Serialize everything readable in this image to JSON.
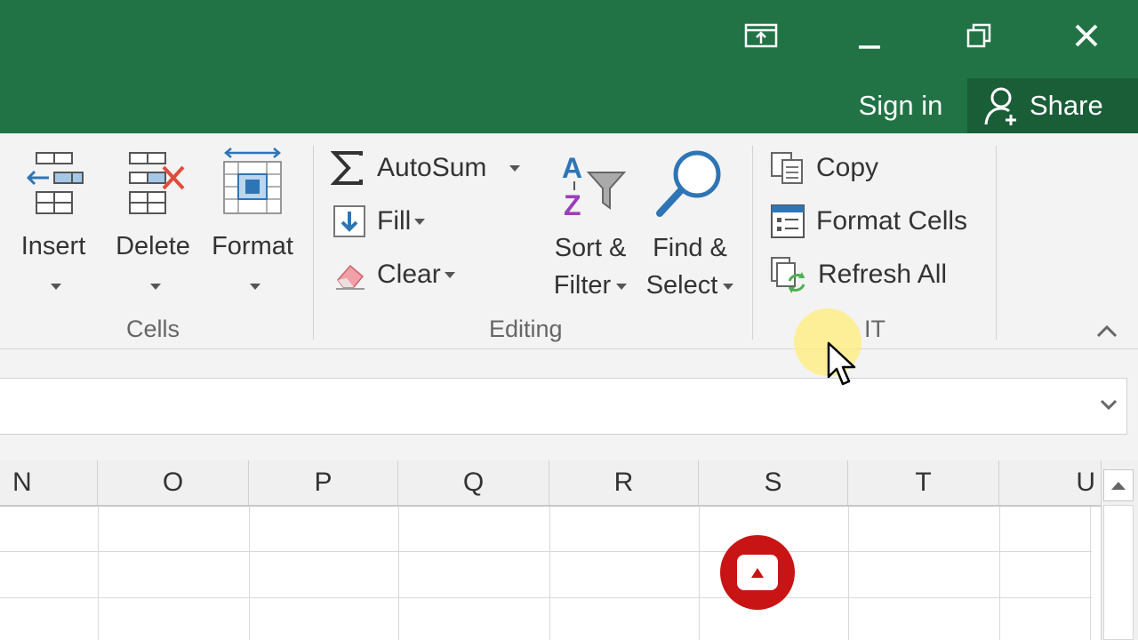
{
  "window": {
    "share_label": "Share",
    "signin_label": "Sign in"
  },
  "ribbon": {
    "cells": {
      "insert": "Insert",
      "delete": "Delete",
      "format": "Format",
      "group": "Cells"
    },
    "editing": {
      "autosum": "AutoSum",
      "fill": "Fill",
      "clear": "Clear",
      "sort1": "Sort &",
      "sort2": "Filter",
      "find1": "Find &",
      "find2": "Select",
      "group": "Editing"
    },
    "custom": {
      "copy": "Copy",
      "format_cells": "Format Cells",
      "refresh_all": "Refresh All",
      "group_partial": "IT"
    }
  },
  "columns": [
    "N",
    "O",
    "P",
    "Q",
    "R",
    "S",
    "T",
    "U"
  ],
  "colors": {
    "brand": "#217346",
    "share_bg": "#1a5e38",
    "badge": "#c81414"
  }
}
